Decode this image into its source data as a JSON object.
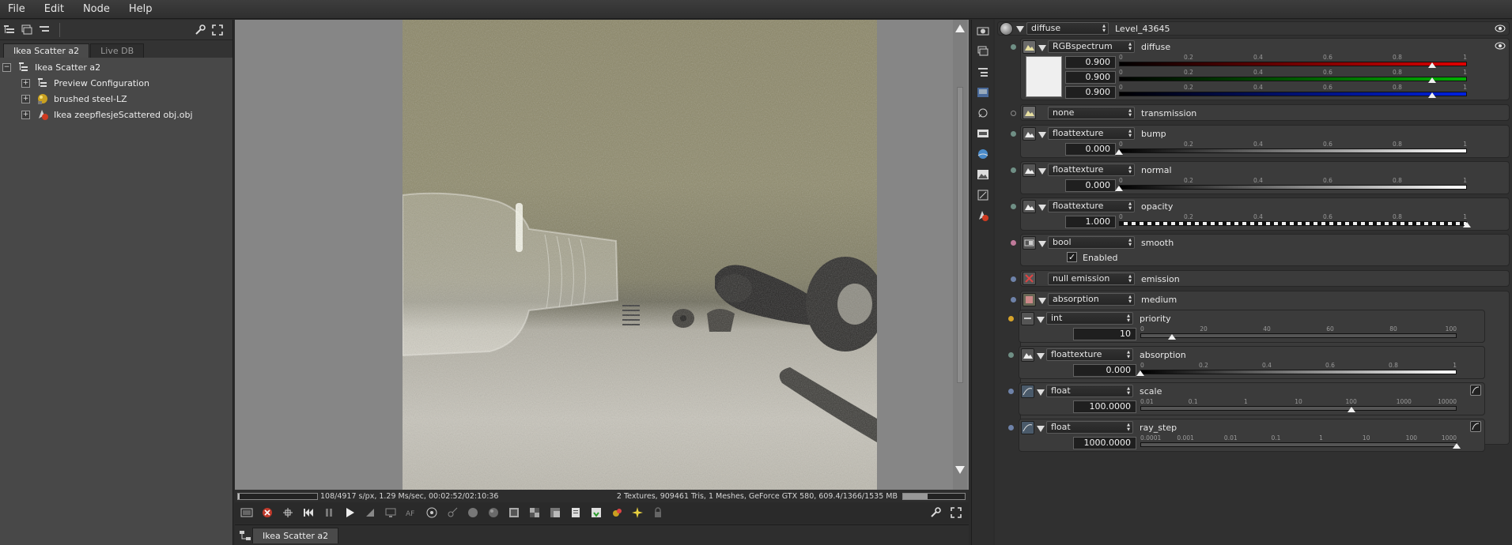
{
  "menu": [
    "File",
    "Edit",
    "Node",
    "Help"
  ],
  "scene_tabs": [
    "Ikea Scatter a2",
    "Live DB"
  ],
  "tree": {
    "root": "Ikea Scatter a2",
    "children": [
      "Preview Configuration",
      "brushed steel-LZ",
      "Ikea zeepflesjeScattered obj.obj"
    ]
  },
  "status": {
    "left": "108/4917 s/px, 1.29 Ms/sec, 00:02:52/02:10:36",
    "right": "2 Textures, 909461 Tris, 1 Meshes, GeForce GTX 580, 609.4/1366/1535 MB",
    "progress": 0.02,
    "memory_fraction": 0.4
  },
  "bottom_tab": "Ikea Scatter a2",
  "inspector": {
    "header": {
      "type": "diffuse",
      "name": "Level_43645"
    },
    "diffuse": {
      "type": "RGBspectrum",
      "label": "diffuse",
      "r": "0.900",
      "g": "0.900",
      "b": "0.900",
      "ticks": [
        "0",
        "0.2",
        "0.4",
        "0.6",
        "0.8",
        "1"
      ],
      "value": 0.9
    },
    "transmission": {
      "type": "none",
      "label": "transmission"
    },
    "bump": {
      "type": "floattexture",
      "label": "bump",
      "value": "0.000",
      "ticks": [
        "0",
        "0.2",
        "0.4",
        "0.6",
        "0.8",
        "1"
      ],
      "fraction": 0
    },
    "normal": {
      "type": "floattexture",
      "label": "normal",
      "value": "0.000",
      "ticks": [
        "0",
        "0.2",
        "0.4",
        "0.6",
        "0.8",
        "1"
      ],
      "fraction": 0
    },
    "opacity": {
      "type": "floattexture",
      "label": "opacity",
      "value": "1.000",
      "ticks": [
        "0",
        "0.2",
        "0.4",
        "0.6",
        "0.8",
        "1"
      ],
      "fraction": 1
    },
    "smooth": {
      "type": "bool",
      "label": "smooth",
      "check_label": "Enabled",
      "checked": true
    },
    "emission": {
      "type": "null emission",
      "label": "emission"
    },
    "medium": {
      "type": "absorption",
      "label": "medium"
    },
    "priority": {
      "type": "int",
      "label": "priority",
      "value": "10",
      "ticks": [
        "0",
        "20",
        "40",
        "60",
        "80",
        "100"
      ],
      "fraction": 0.1
    },
    "absorption": {
      "type": "floattexture",
      "label": "absorption",
      "value": "0.000",
      "ticks": [
        "0",
        "0.2",
        "0.4",
        "0.6",
        "0.8",
        "1"
      ],
      "fraction": 0
    },
    "scale": {
      "type": "float",
      "label": "scale",
      "value": "100.0000",
      "ticks": [
        "0.01",
        "0.1",
        "1",
        "10",
        "100",
        "1000",
        "10000"
      ],
      "fraction": 0.6667
    },
    "ray_step": {
      "type": "float",
      "label": "ray_step",
      "value": "1000.0000",
      "ticks": [
        "0.0001",
        "0.001",
        "0.01",
        "0.1",
        "1",
        "10",
        "100",
        "1000"
      ],
      "fraction": 1
    }
  },
  "colors": {
    "accent_dot": "#6f8f85",
    "priority_dot": "#d6a32a",
    "smooth_dot": "#c07a9a",
    "medium_dot": "#6e82a8"
  },
  "icons": [
    "scene-tree-icon",
    "wrench-icon",
    "fullscreen-icon",
    "play-icon",
    "pause-icon",
    "rewind-icon"
  ]
}
